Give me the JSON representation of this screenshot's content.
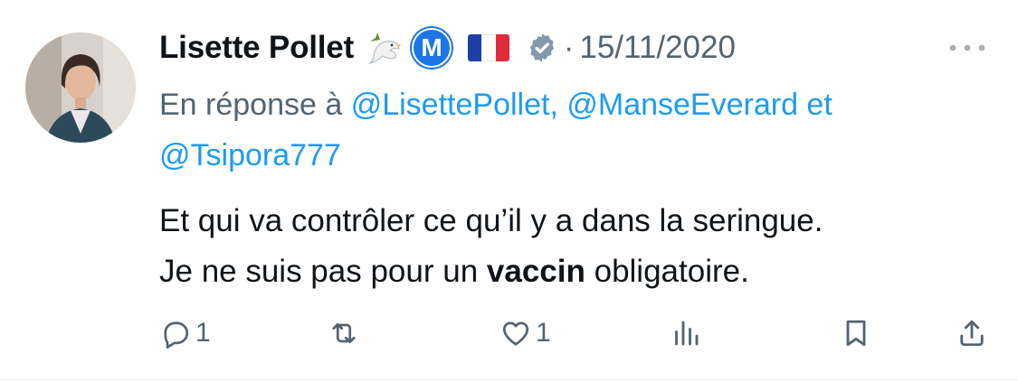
{
  "author": {
    "name": "Lisette Pollet",
    "badge_letter": "M",
    "flag": "fr-flag",
    "verified": true
  },
  "tweet": {
    "separator": "·",
    "date": "15/11/2020",
    "replying_prefix": "En réponse à ",
    "mention_1": "@LisettePollet",
    "mention_sep": ", ",
    "mention_2": "@ManseEverard",
    "mention_and": " et",
    "mention_3": "@Tsipora777",
    "line1": "Et qui va contrôler ce qu’il y a dans la seringue.",
    "line2_before": "Je ne suis pas pour un ",
    "line2_bold": "vaccin",
    "line2_after": " obligatoire."
  },
  "actions": {
    "reply_count": "1",
    "retweet_count": "",
    "like_count": "1"
  },
  "colors": {
    "text": "#0f1419",
    "muted": "#536471",
    "link": "#1d9bf0",
    "badge": "#1d76e6"
  }
}
